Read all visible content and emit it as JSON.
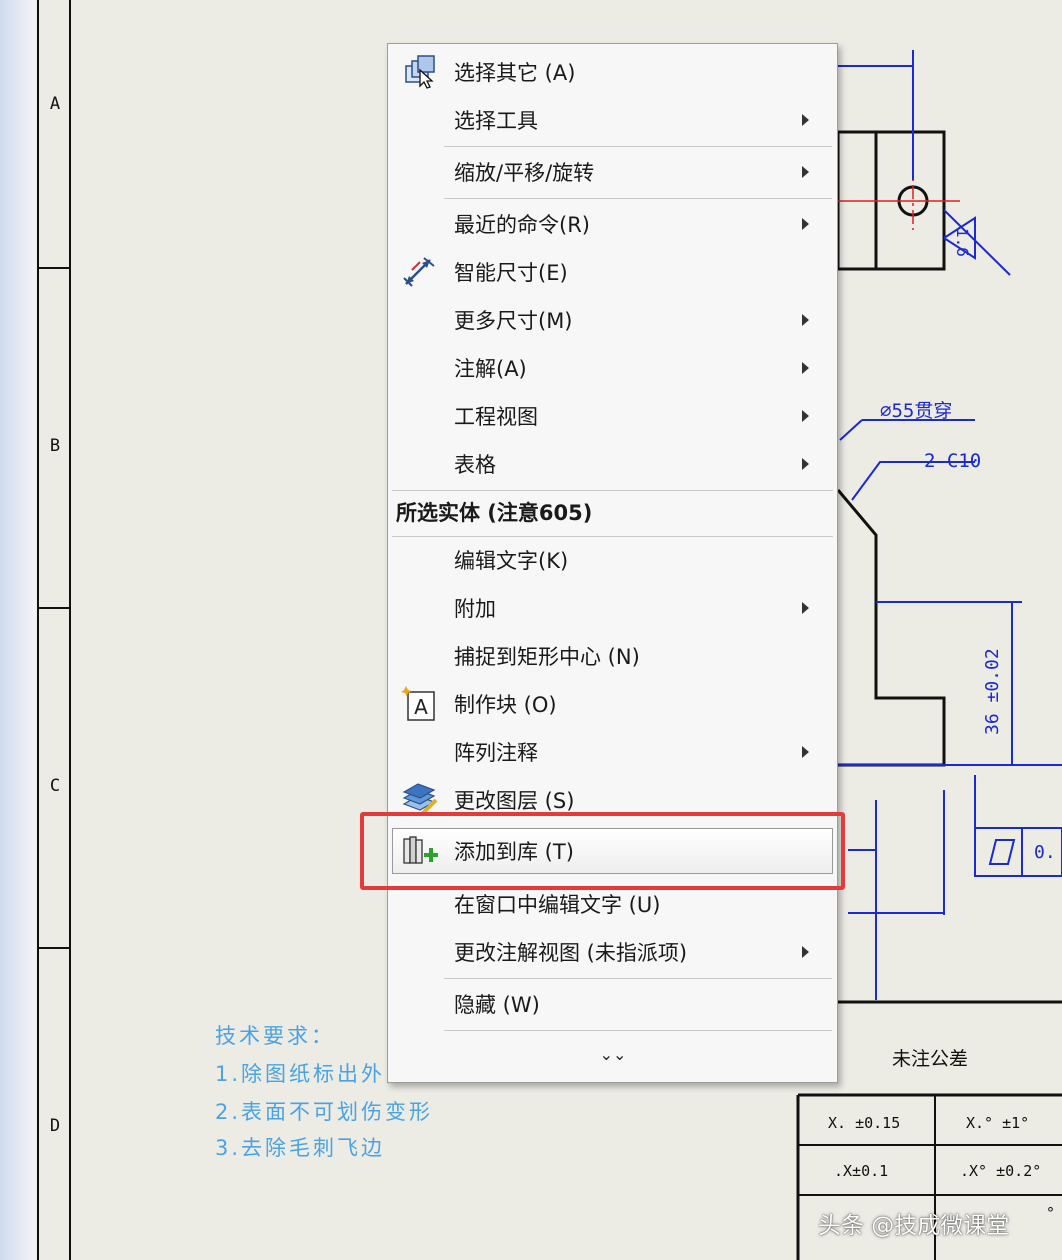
{
  "drawing": {
    "zone_labels": [
      "A",
      "B",
      "C",
      "D"
    ],
    "tech_requirements": {
      "title": "技术要求：",
      "items": [
        "1.除图纸标出外，",
        "2.表面不可划伤变形",
        "3.去除毛刺飞边"
      ]
    },
    "annotations": {
      "diameter": "∅55贯穿",
      "chamfer": "2-C10",
      "roughness": "1.6",
      "dimension": "36 ±0.02",
      "flatness_value": "0."
    },
    "tolerance_table": {
      "title": "未注公差",
      "rows": [
        [
          "X. ±0.15",
          "X.° ±1°"
        ],
        [
          ".X±0.1",
          ".X° ±0.2°"
        ],
        [
          "",
          "°"
        ]
      ]
    }
  },
  "context_menu": {
    "items": [
      {
        "label": "选择其它 (A)",
        "icon": "select-other-icon",
        "submenu": false
      },
      {
        "label": "选择工具",
        "submenu": true
      },
      {
        "label": "缩放/平移/旋转",
        "submenu": true
      },
      {
        "label": "最近的命令(R)",
        "submenu": true
      },
      {
        "label": "智能尺寸(E)",
        "icon": "smart-dimension-icon",
        "submenu": false
      },
      {
        "label": "更多尺寸(M)",
        "submenu": true
      },
      {
        "label": "注解(A)",
        "submenu": true
      },
      {
        "label": "工程视图",
        "submenu": true
      },
      {
        "label": "表格",
        "submenu": true
      }
    ],
    "section_header": "所选实体 (注意605)",
    "section_items": [
      {
        "label": "编辑文字(K)",
        "submenu": false
      },
      {
        "label": "附加",
        "submenu": true
      },
      {
        "label": "捕捉到矩形中心 (N)",
        "submenu": false
      },
      {
        "label": "制作块 (O)",
        "icon": "make-block-icon",
        "submenu": false
      },
      {
        "label": "阵列注释",
        "submenu": true
      },
      {
        "label": "更改图层 (S)",
        "icon": "change-layer-icon",
        "submenu": false
      },
      {
        "label": "添加到库 (T)",
        "icon": "add-to-library-icon",
        "submenu": false,
        "highlighted": true
      },
      {
        "label": "在窗口中编辑文字 (U)",
        "submenu": false
      },
      {
        "label": "更改注解视图 (未指派项)",
        "submenu": true
      },
      {
        "label": "隐藏 (W)",
        "submenu": false
      }
    ],
    "expand_glyph": "⌄⌄"
  },
  "watermark": "头条 @技成微课堂",
  "colors": {
    "drawing_blue": "#1a2ad6",
    "tech_text": "#4aa3e6",
    "highlight_border": "#e23b3b",
    "menu_bg": "#f7f7f7",
    "sheet_bg": "#ecebe4"
  }
}
